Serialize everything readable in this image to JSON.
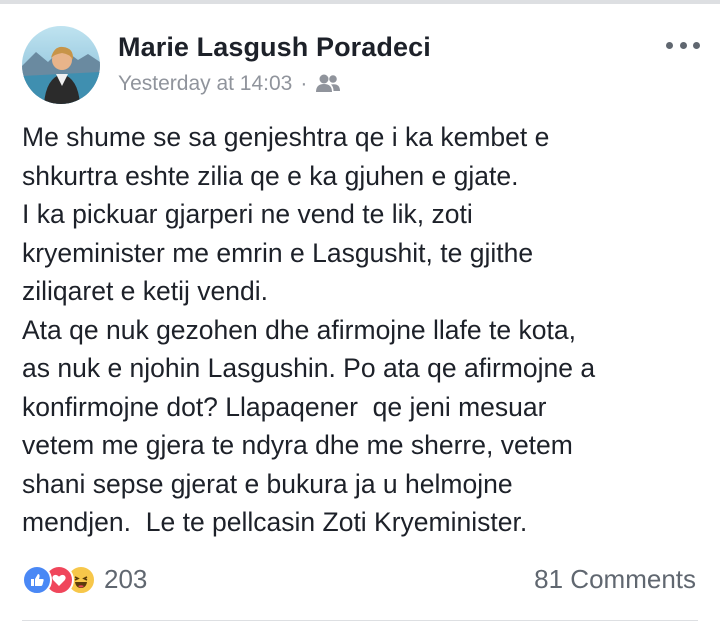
{
  "post": {
    "author": "Marie Lasgush Poradeci",
    "timestamp": "Yesterday at 14:03",
    "separator": "·",
    "audience_icon": "friends-icon",
    "more_icon": "more-options-icon",
    "text_lines": [
      "Me shume se sa genjeshtra qe i ka kembet e",
      "shkurtra eshte zilia qe e ka gjuhen e gjate.",
      "I ka pickuar gjarperi ne vend te lik, zoti",
      "kryeminister me emrin e Lasgushit, te gjithe",
      "ziliqaret e ketij vendi.",
      "Ata qe nuk gezohen dhe afirmojne llafe te kota,",
      "as nuk e njohin Lasgushin. Po ata qe afirmojne a",
      "konfirmojne dot? Llapaqener  qe jeni mesuar",
      "vetem me gjera te ndyra dhe me sherre, vetem",
      "shani sepse gjerat e bukura ja u helmojne",
      "mendjen.  Le te pellcasin Zoti Kryeminister."
    ]
  },
  "footer": {
    "reaction_icons": [
      "like-icon",
      "love-icon",
      "haha-icon"
    ],
    "reaction_count": "203",
    "comments": "81 Comments"
  },
  "colors": {
    "text": "#1d2129",
    "meta": "#90949c",
    "like": "#4a88f5",
    "love": "#f0465b",
    "haha": "#f7c74a"
  }
}
